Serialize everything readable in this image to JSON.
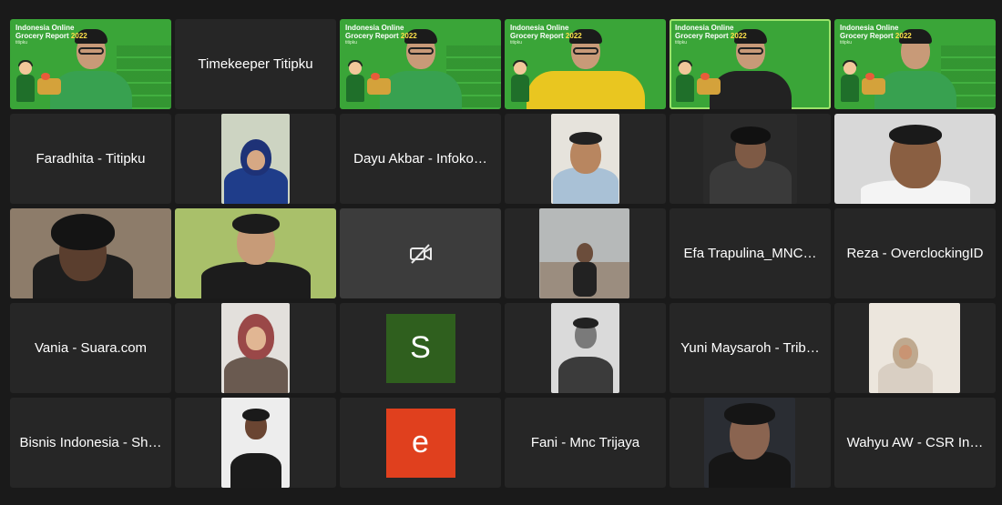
{
  "banner": {
    "title_line1": "Indonesia Online",
    "title_line2": "Grocery Report",
    "year": "2022",
    "sub": "titipku",
    "accent_green": "#3aa538",
    "accent_yellow": "#ffe14a"
  },
  "participants": {
    "timekeeper": "Timekeeper Titipku",
    "faradhita": "Faradhita - Titipku",
    "dayu": "Dayu Akbar - Infoko…",
    "efa": "Efa Trapulina_MNC…",
    "reza": "Reza - OverclockingID",
    "vania": "Vania - Suara.com",
    "yuni": "Yuni Maysaroh - Trib…",
    "bisnis": "Bisnis Indonesia - Sh…",
    "fani": "Fani - Mnc Trijaya",
    "wahyu": "Wahyu AW - CSR In…"
  },
  "avatars": {
    "s": {
      "letter": "S",
      "color": "#2f5f1e"
    },
    "e": {
      "letter": "e",
      "color": "#e0401e"
    }
  },
  "icons": {
    "camera_off": "camera-off-icon"
  },
  "active_speaker_color": "#9be36a"
}
